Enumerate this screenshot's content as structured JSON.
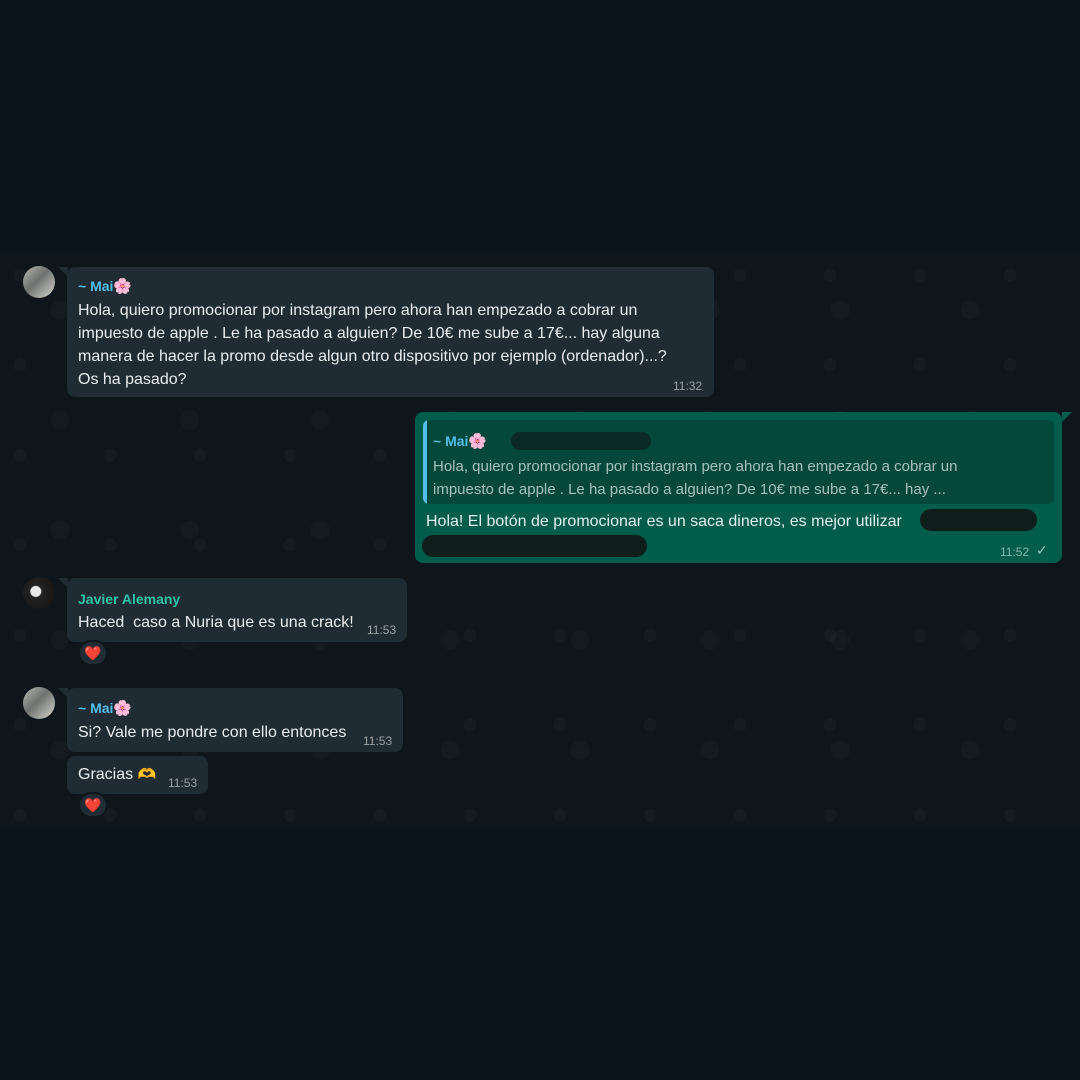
{
  "messages": [
    {
      "sender": "~ Mai",
      "sender_emoji": "🌸",
      "text_lines": [
        "Hola, quiero promocionar por instagram pero ahora han empezado a cobrar un",
        "impuesto de apple . Le ha pasado a alguien? De 10€ me sube a 17€... hay alguna",
        "manera de hacer la promo desde algun otro dispositivo por ejemplo (ordenador)...?",
        "Os ha pasado?"
      ],
      "time": "11:32"
    },
    {
      "quote": {
        "sender": "~ Mai",
        "sender_emoji": "🌸",
        "text_lines": [
          "Hola, quiero promocionar por instagram pero ahora han empezado a cobrar un",
          "impuesto de apple . Le ha pasado a alguien? De 10€ me sube a 17€... hay ..."
        ]
      },
      "text": "Hola! El botón de promocionar es un saca dineros, es mejor utilizar",
      "time": "11:52",
      "status_icon": "single-check"
    },
    {
      "sender": "Javier Alemany",
      "text": "Haced  caso a Nuria que es una crack!",
      "time": "11:53",
      "reaction": "❤️"
    },
    {
      "sender": "~ Mai",
      "sender_emoji": "🌸",
      "text": "Si? Vale me pondre con ello entonces",
      "time": "11:53"
    },
    {
      "text": "Gracias",
      "emoji": "🫶",
      "time": "11:53",
      "reaction": "❤️"
    }
  ],
  "colors": {
    "incoming_bubble": "#1f2c33",
    "outgoing_bubble": "#005c4b",
    "mai_name": "#53bdeb",
    "javier_name": "#2ec2a8"
  }
}
